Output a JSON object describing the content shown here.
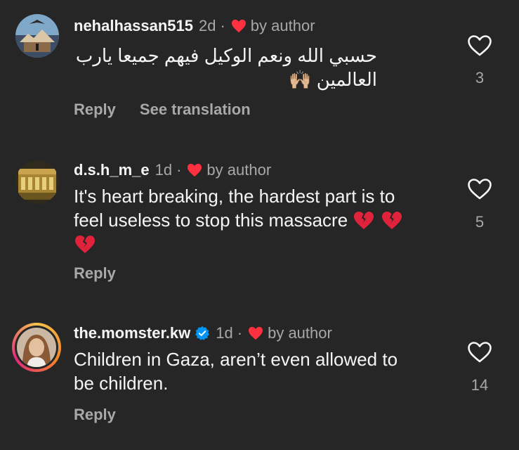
{
  "comments": [
    {
      "username": "nehalhassan515",
      "time": "2d",
      "dot": "·",
      "by_author": "by author",
      "text_line1": "حسبي الله ونعم الوكيل فيهم جميعا يارب",
      "text_line2": "العالمين",
      "text_emoji": "🙌🏼",
      "reply": "Reply",
      "translate": "See translation",
      "likes": "3",
      "avatar_icon": "landscape-avatar-icon",
      "verified": false
    },
    {
      "username": "d.s.h_m_e",
      "time": "1d",
      "dot": "·",
      "by_author": "by author",
      "text_line1": "It's heart breaking, the hardest part is to",
      "text_line2": "feel useless to stop this massacre",
      "reply": "Reply",
      "likes": "5",
      "avatar_icon": "building-avatar-icon",
      "verified": false
    },
    {
      "username": "the.momster.kw",
      "time": "1d",
      "dot": "·",
      "by_author": "by author",
      "text_line1": "Children in Gaza, aren’t even allowed to",
      "text_line2": "be children.",
      "reply": "Reply",
      "likes": "14",
      "avatar_icon": "portrait-avatar-icon",
      "verified": true
    }
  ],
  "colors": {
    "background": "#262626",
    "primary_text": "#f5f5f5",
    "secondary_text": "#a8a8a8",
    "heart_red": "#ff3040",
    "verified_blue": "#0095f6"
  }
}
